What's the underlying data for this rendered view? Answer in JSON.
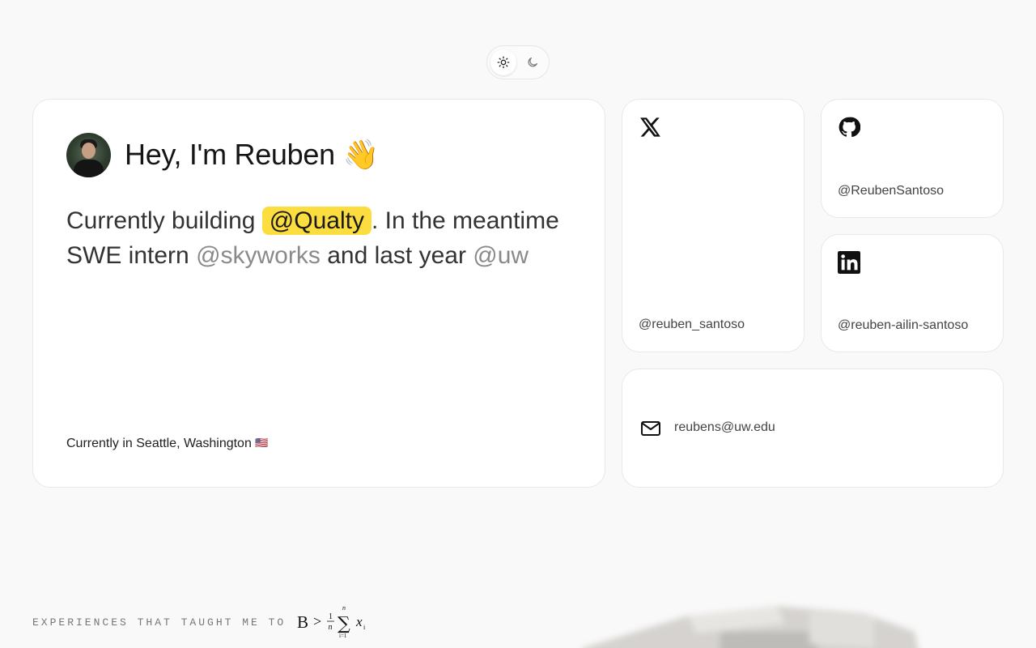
{
  "theme_toggle": {
    "light_icon": "sun-icon",
    "dark_icon": "moon-icon",
    "active": "light"
  },
  "intro": {
    "greeting": "Hey, I'm Reuben 👋",
    "about_prefix": "Currently building ",
    "current_company": "@Qualty",
    "about_middle": ". In the meantime SWE intern ",
    "internship": "@skyworks",
    "about_connector": " and last year ",
    "school": "@uw",
    "location_text": "Currently in Seattle, Washington ",
    "location_flag": "🇺🇸"
  },
  "socials": {
    "x": {
      "icon": "x-logo-icon",
      "handle": "@reuben_santoso"
    },
    "github": {
      "icon": "github-icon",
      "handle": "@ReubenSantoso"
    },
    "linkedin": {
      "icon": "linkedin-icon",
      "handle": "@reuben-ailin-santoso"
    },
    "email": {
      "icon": "mail-icon",
      "address": "reubens@uw.edu"
    }
  },
  "experiences": {
    "label": "EXPERIENCES THAT TAUGHT ME TO",
    "formula_lhs": "B",
    "formula_op": ">",
    "formula_num": "1",
    "formula_den": "n",
    "formula_sum_top": "n",
    "formula_sum_bottom": "i=1",
    "formula_term": "x",
    "formula_sub": "i"
  },
  "colors": {
    "highlight": "#fbdd3f",
    "background": "#f9f9f9",
    "card": "#ffffff",
    "muted_link": "#8a8a8a"
  }
}
